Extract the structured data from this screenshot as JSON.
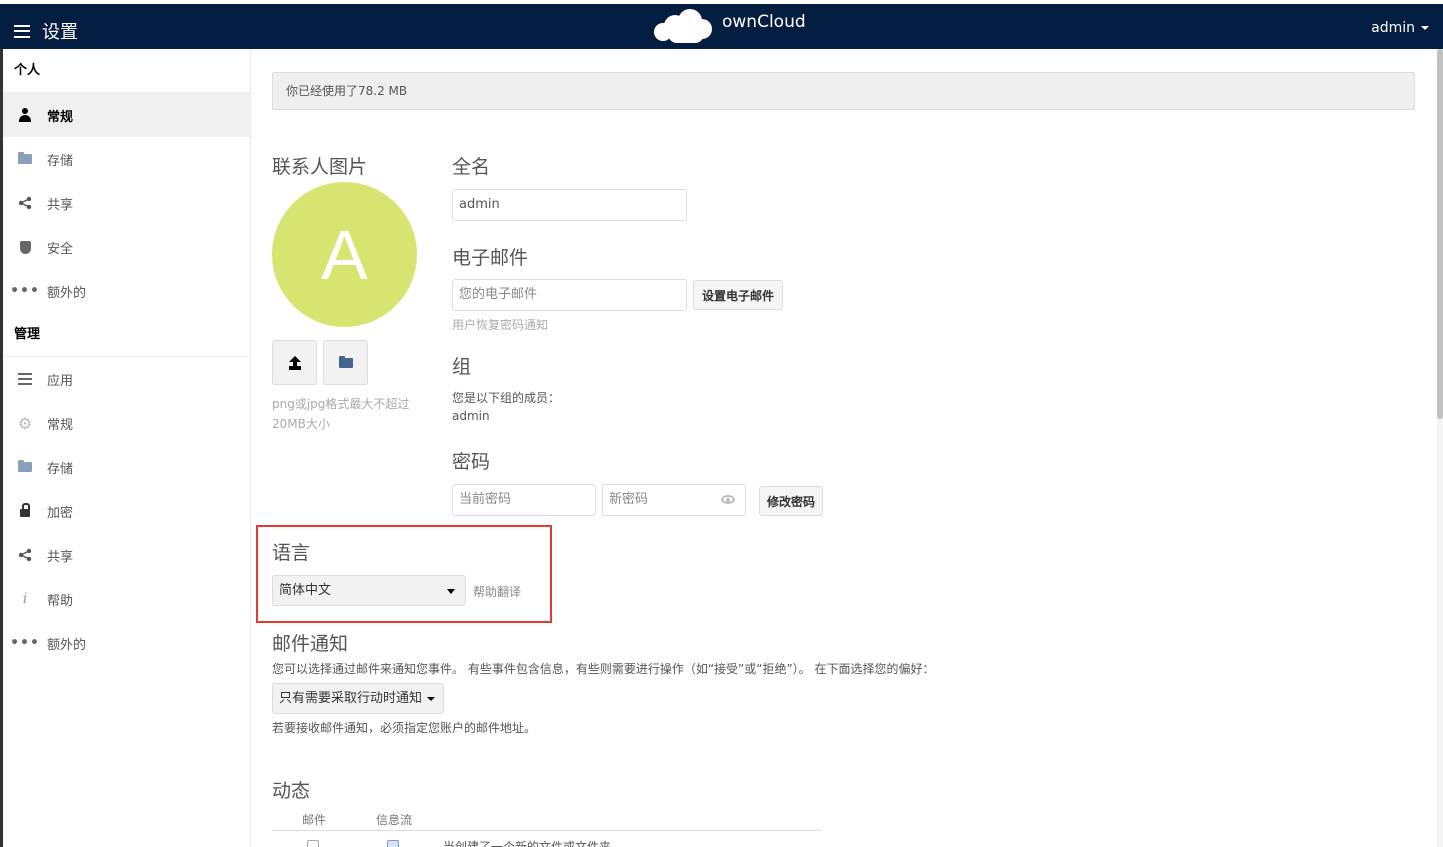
{
  "header": {
    "app_title": "设置",
    "brand": "ownCloud",
    "user": "admin"
  },
  "sidebar": {
    "personal_title": "个人",
    "personal_items": [
      {
        "label": "常规",
        "icon": "person-icon",
        "active": true
      },
      {
        "label": "存储",
        "icon": "folder-icon"
      },
      {
        "label": "共享",
        "icon": "share-icon"
      },
      {
        "label": "安全",
        "icon": "shield-icon"
      },
      {
        "label": "额外的",
        "icon": "more-icon"
      }
    ],
    "admin_title": "管理",
    "admin_items": [
      {
        "label": "应用",
        "icon": "list-icon"
      },
      {
        "label": "常规",
        "icon": "gear-icon"
      },
      {
        "label": "存储",
        "icon": "folder-icon"
      },
      {
        "label": "加密",
        "icon": "lock-icon"
      },
      {
        "label": "共享",
        "icon": "share-icon"
      },
      {
        "label": "帮助",
        "icon": "info-icon"
      },
      {
        "label": "额外的",
        "icon": "more-icon"
      }
    ]
  },
  "quota": {
    "text": "你已经使用了78.2 MB"
  },
  "avatar": {
    "title": "联系人图片",
    "letter": "A",
    "color": "#d5e56f",
    "hint": "png或jpg格式最大不超过20MB大小"
  },
  "fullname": {
    "title": "全名",
    "value": "admin"
  },
  "email": {
    "title": "电子邮件",
    "placeholder": "您的电子邮件",
    "button": "设置电子邮件",
    "hint": "用户恢复密码通知"
  },
  "groups": {
    "title": "组",
    "label": "您是以下组的成员：",
    "value": "admin"
  },
  "password": {
    "title": "密码",
    "current_placeholder": "当前密码",
    "new_placeholder": "新密码",
    "button": "修改密码"
  },
  "language": {
    "title": "语言",
    "selected": "简体中文",
    "help_link": "帮助翻译",
    "highlight_color": "#e53935"
  },
  "mail_notifications": {
    "title": "邮件通知",
    "description": "您可以选择通过邮件来通知您事件。 有些事件包含信息，有些则需要进行操作（如“接受”或“拒绝”）。 在下面选择您的偏好：",
    "dropdown": "只有需要采取行动时通知",
    "note": "若要接收邮件通知，必须指定您账户的邮件地址。"
  },
  "activity": {
    "title": "动态",
    "col_mail": "邮件",
    "col_stream": "信息流",
    "row1_label": "当创建了一个新的文件或文件夹"
  },
  "colors": {
    "header_bg": "#041e42",
    "active_item_bg": "#f0f0f0"
  }
}
